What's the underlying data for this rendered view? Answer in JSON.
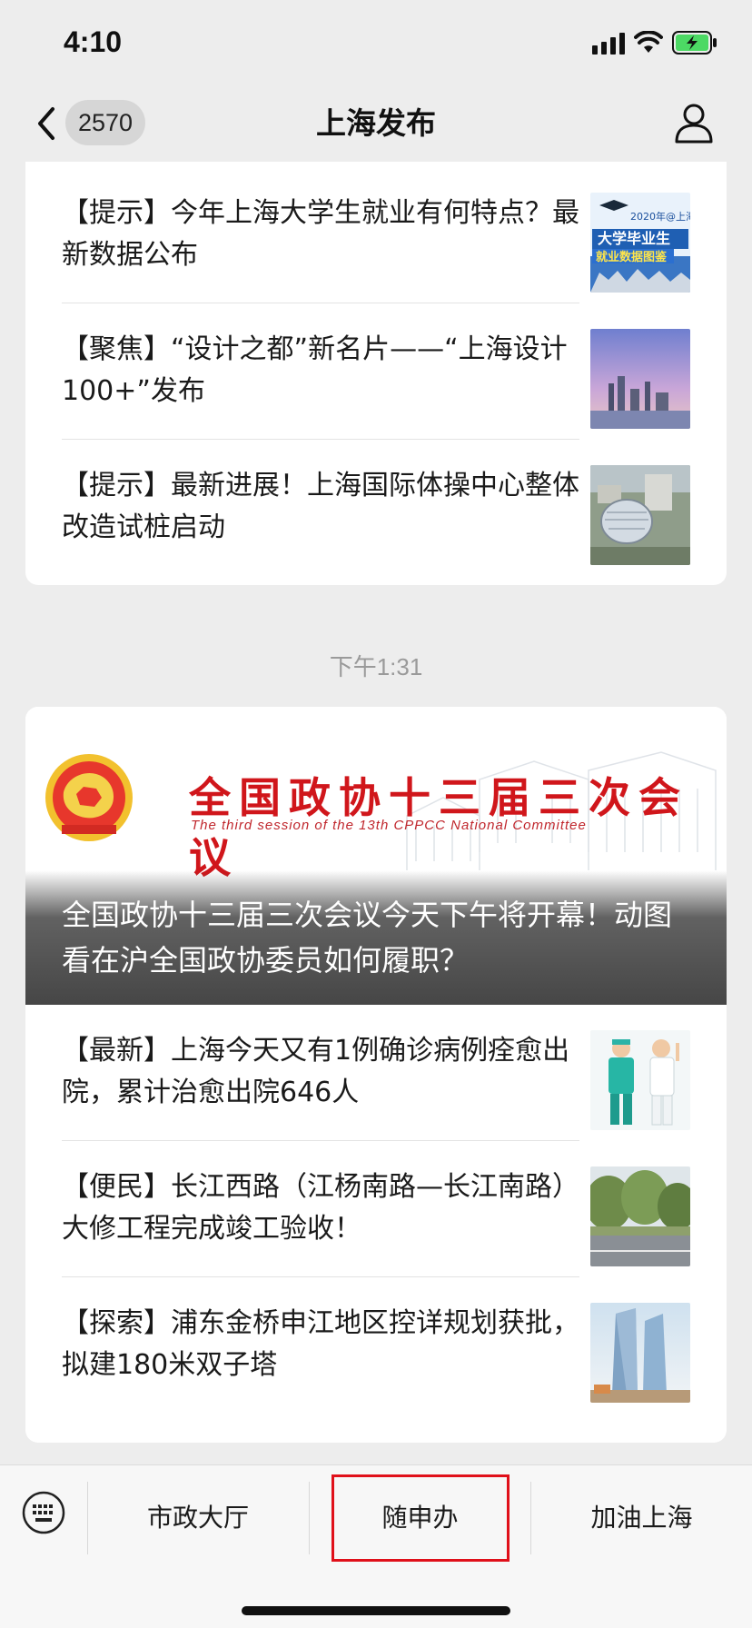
{
  "status": {
    "time": "4:10"
  },
  "nav": {
    "back_count": "2570",
    "title": "上海发布"
  },
  "feed": {
    "group1": [
      {
        "title": "【提示】今年上海大学生就业有何特点？最新数据公布",
        "thumb_text_1": "2020年@上海",
        "thumb_text_2": "大学毕业生",
        "thumb_text_3": "就业数据图鉴"
      },
      {
        "title": "【聚焦】“设计之都”新名片——“上海设计100+”发布"
      },
      {
        "title": "【提示】最新进展！上海国际体操中心整体改造试桩启动"
      }
    ],
    "time_label": "下午1:31",
    "banner": {
      "cn_text": "全国政协十三届三次会议",
      "en_text": "The third session of the 13th CPPCC National Committee",
      "title": "全国政协十三届三次会议今天下午将开幕！动图看在沪全国政协委员如何履职？"
    },
    "group2": [
      {
        "title": "【最新】上海今天又有1例确诊病例痊愈出院，累计治愈出院646人"
      },
      {
        "title": "【便民】长江西路（江杨南路—长江南路）大修工程完成竣工验收！"
      },
      {
        "title": "【探索】浦东金桥申江地区控详规划获批，拟建180米双子塔"
      }
    ]
  },
  "menu": {
    "items": [
      "市政大厅",
      "随申办",
      "加油上海"
    ]
  },
  "colors": {
    "highlight": "#e0101a",
    "cppcc_red": "#d0161b"
  }
}
